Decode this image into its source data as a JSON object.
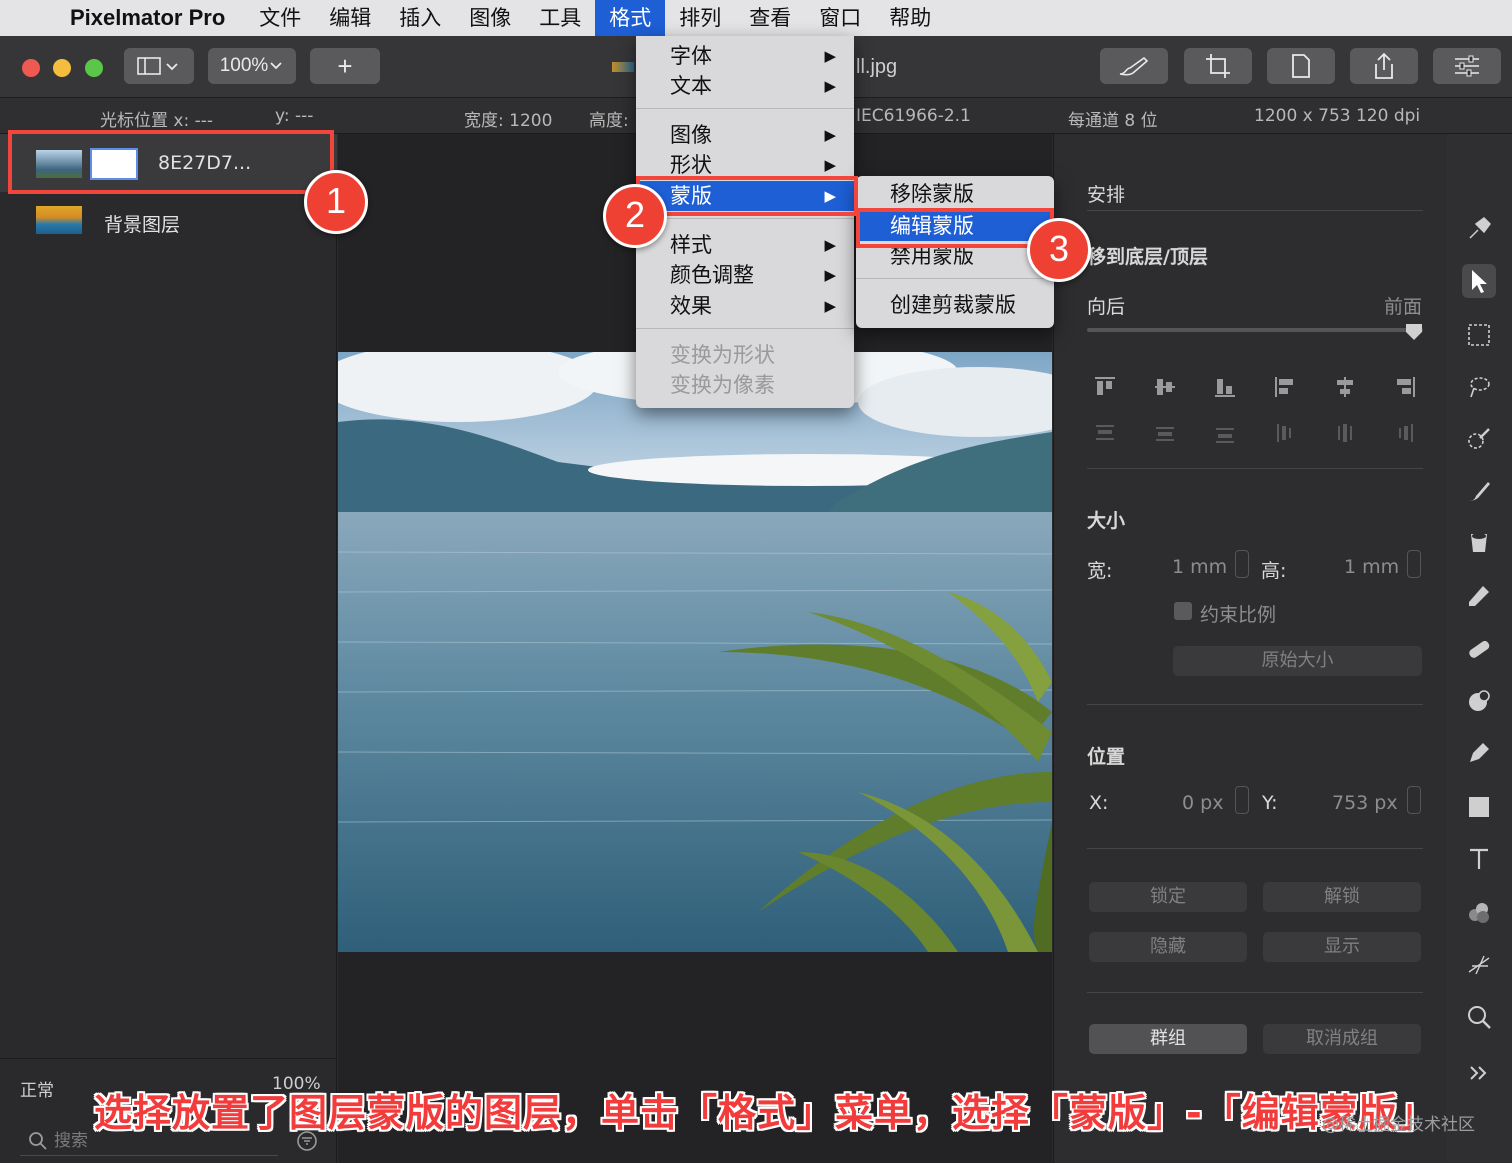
{
  "menubar": {
    "app_name": "Pixelmator Pro",
    "items": [
      "文件",
      "编辑",
      "插入",
      "图像",
      "工具",
      "格式",
      "排列",
      "查看",
      "窗口",
      "帮助"
    ],
    "active_item": "格式"
  },
  "toolbar": {
    "zoom": "100%",
    "add_label": "+",
    "document_title": "ll.jpg"
  },
  "infobar": {
    "cursor_x": "光标位置 x:  ---",
    "cursor_y": "y:  ---",
    "width": "宽度:  1200",
    "height": "高度:",
    "color_profile": "IEC61966-2.1",
    "bit_depth": "每通道 8 位",
    "dimensions": "1200 x 753 120 dpi"
  },
  "layers": {
    "items": [
      {
        "name": "8E27D7...",
        "selected": true,
        "has_mask": true
      },
      {
        "name": "背景图层",
        "selected": false,
        "has_mask": false
      }
    ],
    "blend_mode": "正常",
    "opacity": "100%",
    "search_placeholder": "搜索"
  },
  "format_menu": {
    "items": [
      {
        "label": "字体",
        "submenu": true
      },
      {
        "label": "文本",
        "submenu": true
      },
      {
        "label": "图像",
        "submenu": true
      },
      {
        "label": "形状",
        "submenu": true
      },
      {
        "label": "蒙版",
        "submenu": true,
        "highlighted": true
      },
      {
        "label": "样式",
        "submenu": true
      },
      {
        "label": "颜色调整",
        "submenu": true
      },
      {
        "label": "效果",
        "submenu": true
      },
      {
        "label": "变换为形状",
        "disabled": true
      },
      {
        "label": "变换为像素",
        "disabled": true
      }
    ]
  },
  "mask_submenu": {
    "items": [
      {
        "label": "移除蒙版"
      },
      {
        "label": "编辑蒙版",
        "highlighted": true
      },
      {
        "label": "禁用蒙版"
      },
      {
        "label": "创建剪裁蒙版"
      }
    ]
  },
  "inspector": {
    "arrange_title": "安排",
    "move_label": "移到底层/顶层",
    "back_label": "向后",
    "front_label": "前面",
    "size_title": "大小",
    "width_label": "宽:",
    "width_value": "1 mm",
    "height_label": "高:",
    "height_value": "1 mm",
    "constrain_label": "约束比例",
    "original_size_label": "原始大小",
    "position_title": "位置",
    "x_label": "X:",
    "x_value": "0 px",
    "y_label": "Y:",
    "y_value": "753 px",
    "lock_label": "锁定",
    "unlock_label": "解锁",
    "hide_label": "隐藏",
    "show_label": "显示",
    "group_label": "群组",
    "ungroup_label": "取消成组"
  },
  "annotations": {
    "badges": [
      "1",
      "2",
      "3"
    ],
    "caption": "选择放置了图层蒙版的图层，单击「格式」菜单，选择「蒙版」-「编辑蒙版」",
    "watermark": "@稀土掘金技术社区"
  },
  "colors": {
    "accent": "#1e5fd6",
    "annotation_red": "#f2453c"
  }
}
